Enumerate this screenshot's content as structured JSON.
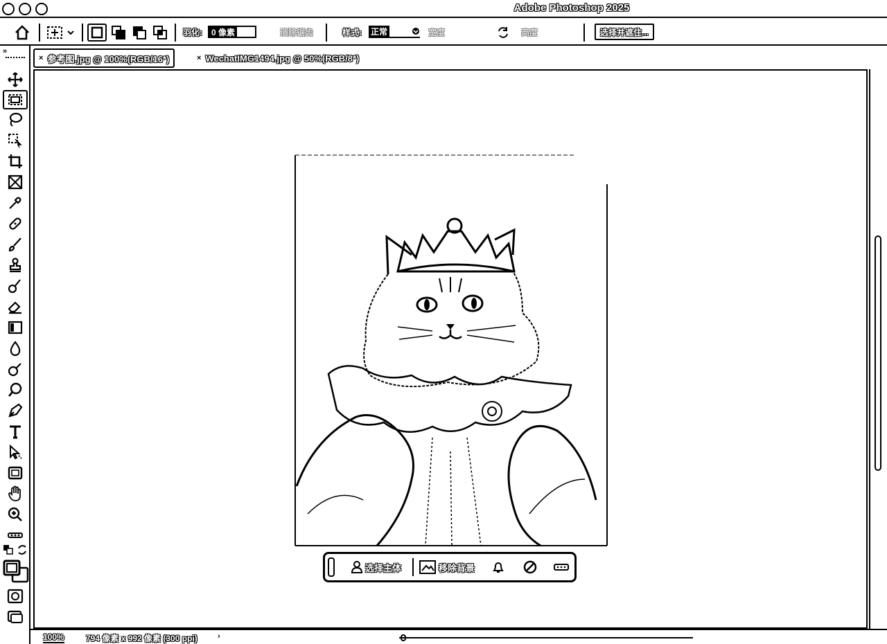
{
  "window": {
    "title": "Adobe Photoshop 2025"
  },
  "options_bar": {
    "feather_label": "羽化:",
    "feather_value": "0 像素",
    "antialias_label": "消除锯齿",
    "style_label": "样式:",
    "style_value": "正常",
    "width_label": "宽度",
    "height_label": "高度",
    "select_mask_label": "选择并遮住..."
  },
  "tabs": [
    {
      "label": "参考图.jpg @ 100%(RGB/16*)",
      "active": true,
      "close": "×"
    },
    {
      "label": "WechatIMG1494.jpg @ 50%(RGB/8*)",
      "active": false,
      "close": "×"
    }
  ],
  "toolbar": {
    "tools": [
      "move-tool-icon",
      "rect-marquee-tool-icon",
      "lasso-tool-icon",
      "object-select-tool-icon",
      "crop-tool-icon",
      "frame-tool-icon",
      "eyedropper-tool-icon",
      "healing-brush-tool-icon",
      "brush-tool-icon",
      "clone-stamp-tool-icon",
      "history-brush-tool-icon",
      "eraser-tool-icon",
      "gradient-tool-icon",
      "blur-tool-icon",
      "dodge-tool-icon",
      "search-icon",
      "pen-tool-icon",
      "type-tool-icon",
      "path-select-tool-icon",
      "rectangle-tool-icon",
      "hand-tool-icon",
      "zoom-tool-icon",
      "more-tools-icon"
    ]
  },
  "context_bar": {
    "select_subject": "选择主体",
    "remove_background": "移除背景"
  },
  "status_bar": {
    "zoom": "100%",
    "doc_info": "794 像素 x 992 像素 (300 ppi)"
  },
  "colors": {
    "ink": "#000000",
    "paper": "#ffffff"
  }
}
